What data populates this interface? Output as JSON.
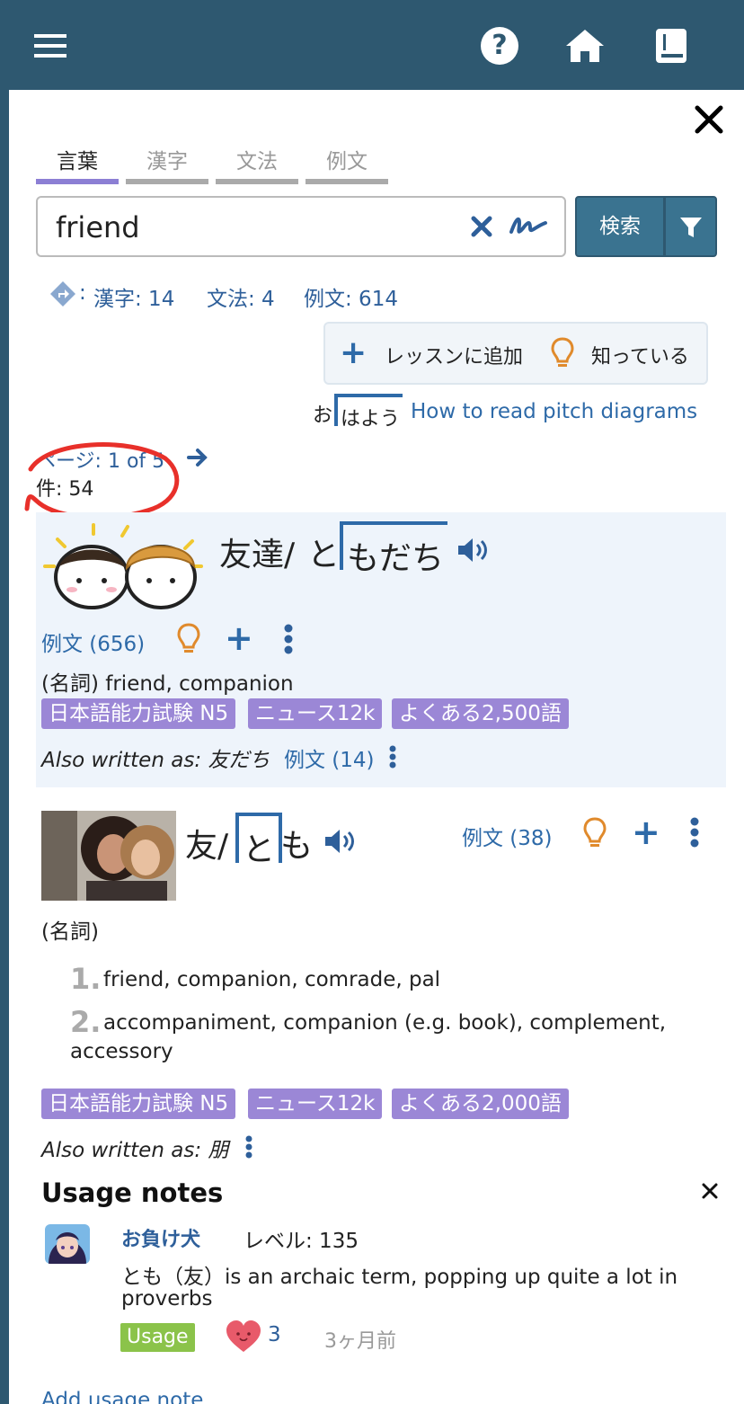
{
  "header": {
    "menu_icon": "hamburger-icon",
    "help_icon": "question-circle-icon",
    "home_icon": "home-icon",
    "book_icon": "book-icon"
  },
  "close_icon": "close-icon",
  "tabs": [
    {
      "label": "言葉",
      "active": true
    },
    {
      "label": "漢字",
      "active": false
    },
    {
      "label": "文法",
      "active": false
    },
    {
      "label": "例文",
      "active": false
    }
  ],
  "search": {
    "value": "friend",
    "button": "検索"
  },
  "counts": {
    "prefix": ":",
    "kanji": "漢字: 14",
    "grammar": "文法: 4",
    "sentences": "例文: 614"
  },
  "actions": {
    "add_lesson": "レッスンに追加",
    "known": "知っている"
  },
  "pitch": {
    "example_o": "お",
    "example_rest": "はよう",
    "link": "How to read pitch diagrams"
  },
  "pagination": {
    "page": "ページ: 1 of 5",
    "results": "件: 54"
  },
  "entries": [
    {
      "word_kanji": "友達/",
      "kana_low": "と",
      "kana_high": "もだち",
      "sentences": "例文 (656)",
      "definition": "(名詞) friend, companion",
      "tags": [
        "日本語能力試験 N5",
        "ニュース12k",
        "よくある2,500語"
      ],
      "also_label": "Also written as",
      "also_value": ": 友だち",
      "also_sentences": "例文 (14)"
    },
    {
      "word_kanji": "友/",
      "kana_high": "と",
      "kana_low": "も",
      "sentences": "例文 (38)",
      "pos": "(名詞)",
      "senses": [
        {
          "num": "1.",
          "text": "friend, companion, comrade, pal"
        },
        {
          "num": "2.",
          "text": "accompaniment, companion (e.g. book), complement,",
          "text2": "accessory"
        }
      ],
      "tags": [
        "日本語能力試験 N5",
        "ニュース12k",
        "よくある2,000語"
      ],
      "also_label": "Also written as",
      "also_value": ": 朋"
    }
  ],
  "usage_notes": {
    "title": "Usage notes",
    "user": "お負け犬",
    "level": "レベル: 135",
    "text1": "とも（友）is an archaic term, popping up quite a lot in",
    "text2": "proverbs",
    "badge": "Usage",
    "likes": "3",
    "time": "3ヶ月前",
    "add_link": "Add usage note"
  },
  "colors": {
    "header_bg": "#2e5870",
    "accent_blue": "#2e6aa8",
    "tag_purple": "#9b87d6",
    "highlight_bg": "#eef4fb",
    "bulb_orange": "#e08a2c",
    "usage_green": "#8bc34a",
    "annotation_red": "#e8302a"
  }
}
